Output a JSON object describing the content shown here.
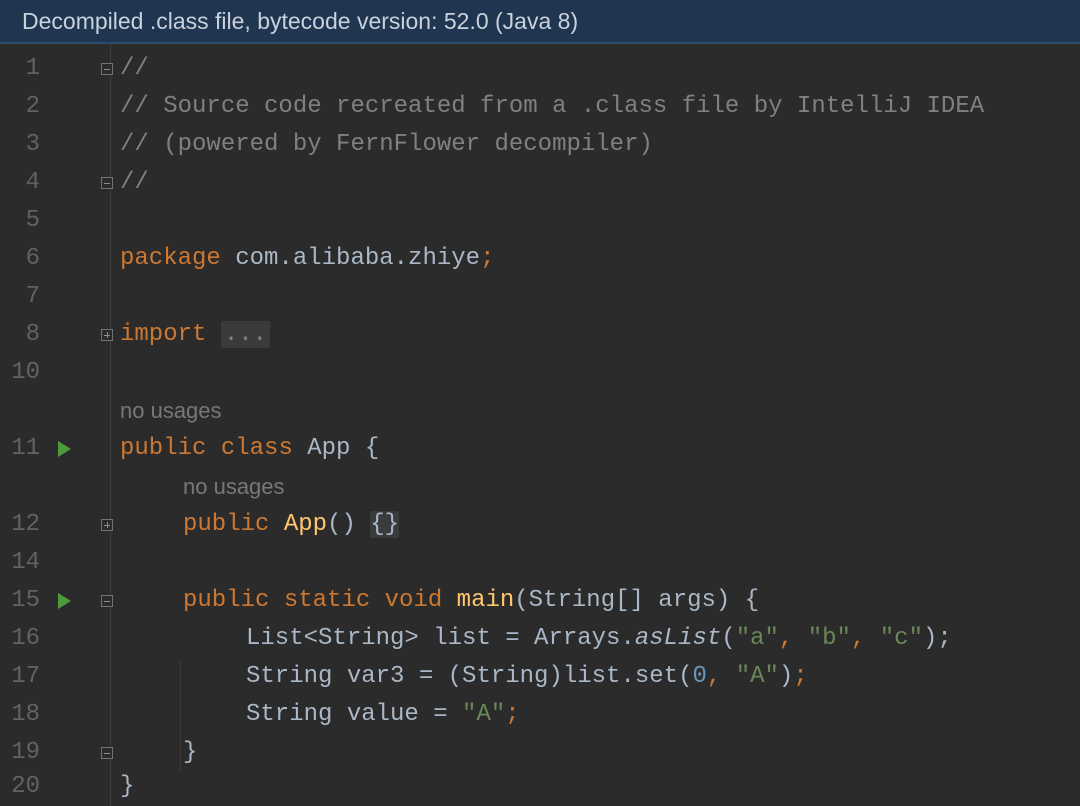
{
  "banner": {
    "text": "Decompiled .class file, bytecode version: 52.0 (Java 8)"
  },
  "line_numbers": [
    "1",
    "2",
    "3",
    "4",
    "5",
    "6",
    "7",
    "8",
    "10",
    "11",
    "12",
    "14",
    "15",
    "16",
    "17",
    "18",
    "19",
    "20"
  ],
  "code": {
    "l1": "//",
    "l2": "// Source code recreated from a .class file by IntelliJ IDEA",
    "l3": "// (powered by FernFlower decompiler)",
    "l4": "//",
    "package_kw": "package",
    "package_name": " com.alibaba.zhiye",
    "semicolon": ";",
    "import_kw": "import",
    "import_fold": "...",
    "class_public": "public",
    "class_kw": "class",
    "class_name": " App {",
    "ctor_public": "public",
    "ctor_name": "App",
    "ctor_parens": "() ",
    "ctor_body": "{}",
    "main_public": "public",
    "main_static": "static",
    "main_void": "void",
    "main_name": "main",
    "main_params": "(String[] args) {",
    "l16_a": "List<String> list = Arrays.",
    "l16_method": "asList",
    "l16_open": "(",
    "l16_s1": "\"a\"",
    "l16_s2": "\"b\"",
    "l16_s3": "\"c\"",
    "comma": ",",
    "l16_close": ");",
    "l17_a": "String var3 = (String)list.set(",
    "l17_num": "0",
    "l17_s": "\"A\"",
    "l17_close": ")",
    "l18_a": "String value = ",
    "l18_s": "\"A\"",
    "l19": "}",
    "l20": "}"
  },
  "hints": {
    "class_usages": "no usages",
    "ctor_usages": "no usages"
  }
}
